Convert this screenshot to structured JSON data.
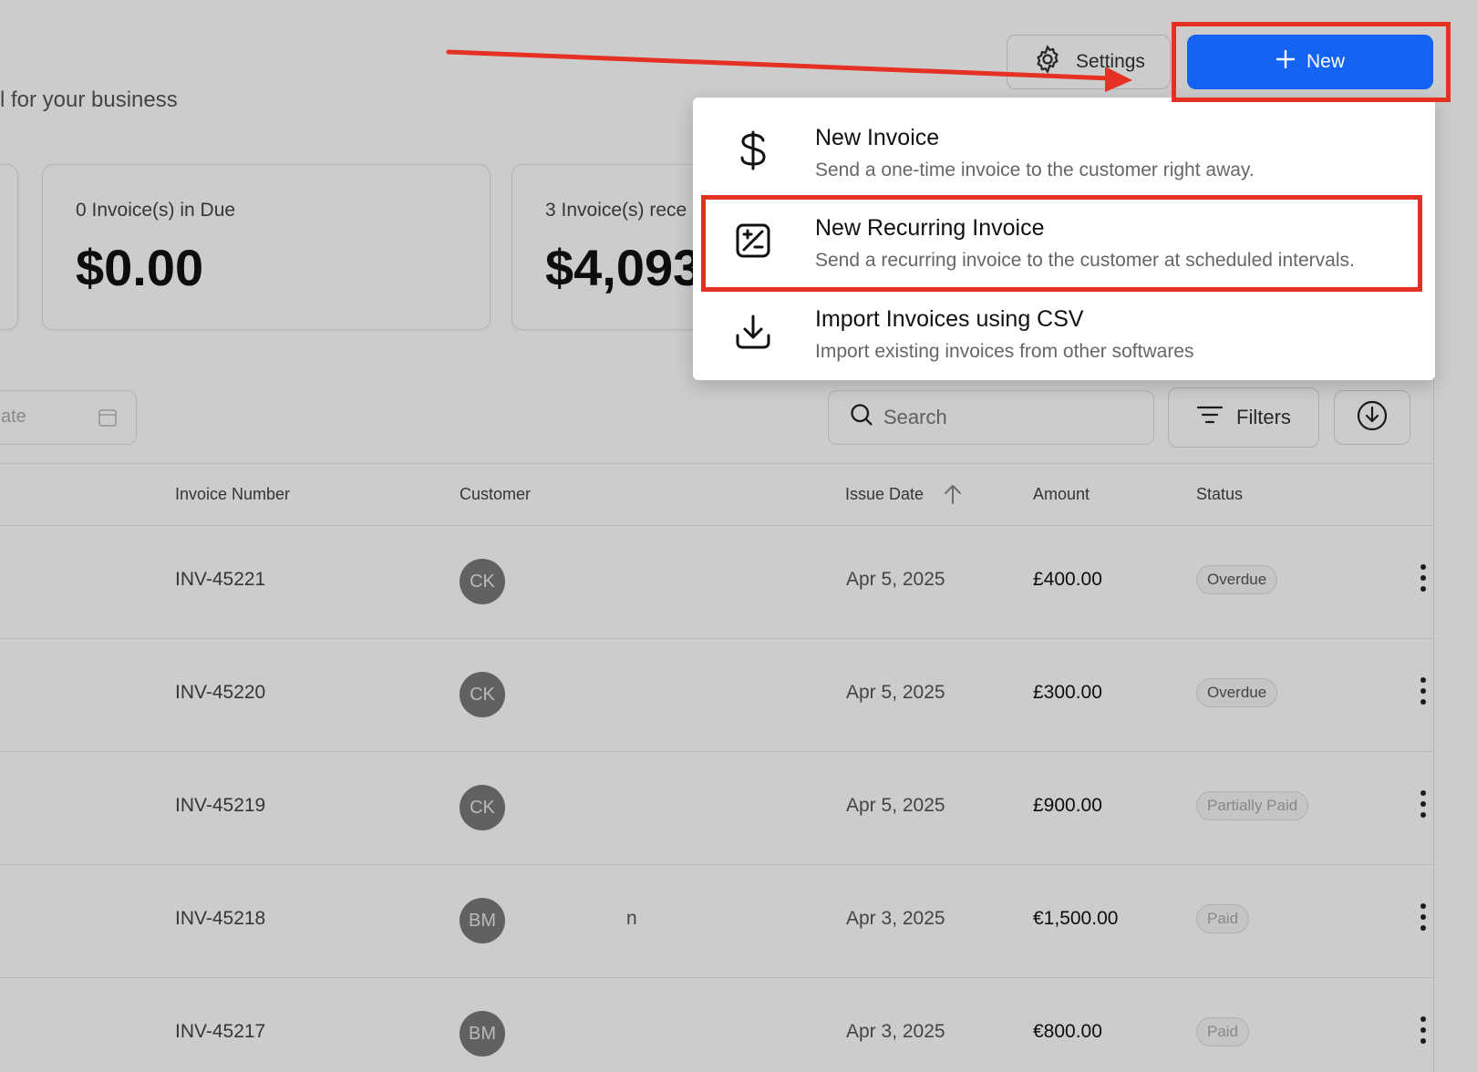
{
  "header": {
    "subtitle": "l for your business",
    "settings_label": "Settings",
    "new_label": "New"
  },
  "stats": [
    {
      "label": "0 Invoice(s) in Due",
      "value": "$0.00"
    },
    {
      "label": "3 Invoice(s) rece",
      "value": "$4,093"
    }
  ],
  "toolbar": {
    "date_placeholder": "ate",
    "search_placeholder": "Search",
    "filters_label": "Filters"
  },
  "table": {
    "columns": [
      "Invoice Number",
      "Customer",
      "Issue Date",
      "Amount",
      "Status"
    ],
    "rows": [
      {
        "invoice": "INV-45221",
        "initials": "CK",
        "date": "Apr 5, 2025",
        "amount": "£400.00",
        "status": "Overdue"
      },
      {
        "invoice": "INV-45220",
        "initials": "CK",
        "date": "Apr 5, 2025",
        "amount": "£300.00",
        "status": "Overdue"
      },
      {
        "invoice": "INV-45219",
        "initials": "CK",
        "date": "Apr 5, 2025",
        "amount": "£900.00",
        "status": "Partially Paid"
      },
      {
        "invoice": "INV-45218",
        "initials": "BM",
        "date": "Apr 3, 2025",
        "amount": "€1,500.00",
        "status": "Paid",
        "name_tail": "n"
      },
      {
        "invoice": "INV-45217",
        "initials": "BM",
        "date": "Apr 3, 2025",
        "amount": "€800.00",
        "status": "Paid"
      }
    ]
  },
  "menu": {
    "items": [
      {
        "title": "New Invoice",
        "desc": "Send a one-time invoice to the customer right away.",
        "icon": "dollar-icon"
      },
      {
        "title": "New Recurring Invoice",
        "desc": "Send a recurring invoice to the customer at scheduled intervals.",
        "icon": "recurring-invoice-icon"
      },
      {
        "title": "Import Invoices using CSV",
        "desc": "Import existing invoices from other softwares",
        "icon": "import-icon"
      }
    ]
  },
  "colors": {
    "primary": "#1563f3",
    "annotation": "#e53024"
  }
}
